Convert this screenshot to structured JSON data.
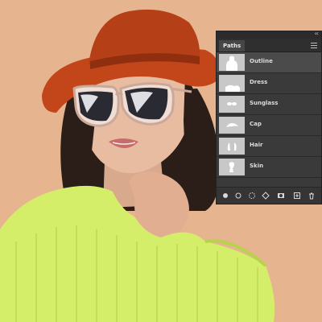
{
  "panel": {
    "tab_label": "Paths",
    "collapse_glyph": "‹‹",
    "paths": [
      {
        "label": "Outline",
        "icon": "outline-thumbnail",
        "selected": true
      },
      {
        "label": "Dress",
        "icon": "dress-thumbnail",
        "selected": false
      },
      {
        "label": "Sunglass",
        "icon": "sunglass-thumbnail",
        "selected": false
      },
      {
        "label": "Cap",
        "icon": "cap-thumbnail",
        "selected": false
      },
      {
        "label": "Hair",
        "icon": "hair-thumbnail",
        "selected": false
      },
      {
        "label": "Skin",
        "icon": "skin-thumbnail",
        "selected": false
      }
    ],
    "tools": [
      "fill-path-icon",
      "stroke-path-icon",
      "load-selection-icon",
      "make-work-path-icon",
      "add-mask-icon",
      "new-path-icon",
      "delete-path-icon"
    ]
  },
  "colors": {
    "background": "#e6b48e",
    "hat": "#c2461a",
    "sweater": "#d4ee6a",
    "panel": "#3a3a3a"
  }
}
